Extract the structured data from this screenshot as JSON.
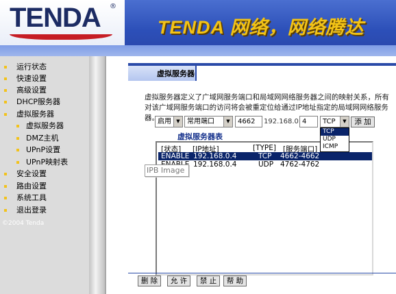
{
  "header": {
    "logo_text": "TENDA",
    "logo_reg": "®",
    "slogan": "TENDA 网络，网络腾达"
  },
  "sidebar": {
    "items": [
      {
        "label": "运行状态"
      },
      {
        "label": "快速设置"
      },
      {
        "label": "高级设置"
      },
      {
        "label": "DHCP服务器"
      },
      {
        "label": "虚拟服务器"
      },
      {
        "label": "虚拟服务器"
      },
      {
        "label": "DMZ主机"
      },
      {
        "label": "UPnP设置"
      },
      {
        "label": "UPnP映射表"
      },
      {
        "label": "安全设置"
      },
      {
        "label": "路由设置"
      },
      {
        "label": "系统工具"
      },
      {
        "label": "退出登录"
      }
    ],
    "copyright": "©2004 Tenda"
  },
  "main": {
    "tab_label": "虚拟服务器",
    "description": "虚拟服务器定义了广域网服务端口和局域网网络服务器之间的映射关系，所有对该广域网服务端口的访问将会被重定位给通过IP地址指定的局域网网络服务器。",
    "form": {
      "enable_value": "启用",
      "port_type_value": "常用端口",
      "port_value": "4662",
      "ip_prefix": "192.168.0.",
      "ip_last": "4",
      "protocol_value": "TCP",
      "add_label": "添 加"
    },
    "protocol_options": [
      "TCP",
      "UDP",
      "ICMP"
    ],
    "table_title": "虚拟服务器表",
    "columns": [
      "[状态]",
      "[IP地址]",
      "[TYPE]",
      "[服务端口]"
    ],
    "rows": [
      {
        "status": "ENABLE",
        "ip": "192.168.0.4",
        "type": "TCP",
        "port": "4662-4662"
      },
      {
        "status": "ENABLE",
        "ip": "192.168.0.4",
        "type": "UDP",
        "port": "4762-4762"
      }
    ],
    "tooltip": "IPB Image",
    "buttons": {
      "delete": "删 除",
      "allow": "允 许",
      "forbid": "禁 止",
      "help": "帮 助"
    }
  }
}
